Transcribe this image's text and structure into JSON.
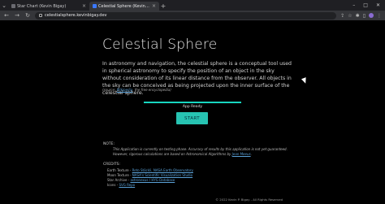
{
  "browser": {
    "tabs": [
      {
        "title": "Star Chart (Kevin Bigay)",
        "active": false
      },
      {
        "title": "Celestial Sphere (Kevin Bigay)",
        "active": true
      }
    ],
    "url": "celestialsphere.kevinbigay.dev"
  },
  "page": {
    "title": "Celestial Sphere",
    "description": "In astronomy and navigation, the celestial sphere is a conceptual tool used in spherical astronomy to specify the position of an object in the sky without consideration of its linear distance from the observer. All objects in the sky can be conceived as being projected upon the inner surface of the celestial sphere.",
    "source_prefix": "(source: ",
    "source_link": "Wikipedia",
    "source_suffix": ", the free encyclopedia)",
    "progress": 1.0,
    "status": "App Ready",
    "start_label": "START",
    "note_heading": "NOTE:",
    "note_line1": "This Application is currently on testing phase. Accuracy of results by this application is not yet guaranteed.",
    "note_line2_prefix": "However, rigorous calculations are based on Astronomical Algorithms by ",
    "note_line2_link": "Jean Meeus",
    "note_line2_suffix": ".",
    "credits_heading": "CREDITS:",
    "credits": [
      {
        "label": "Earth Texture - ",
        "link": "Reto Stöckli, NASA Earth Observatory"
      },
      {
        "label": "Moon Texture - ",
        "link": "NASA's Scientific Visualization Studio"
      },
      {
        "label": "Star Archive - ",
        "link": "astronexus / HYG Database"
      },
      {
        "label": "Icons - ",
        "link": "SVG Repo"
      }
    ],
    "copyright": "© 2022 Kevin P. Bigay - All Rights Reserved"
  }
}
